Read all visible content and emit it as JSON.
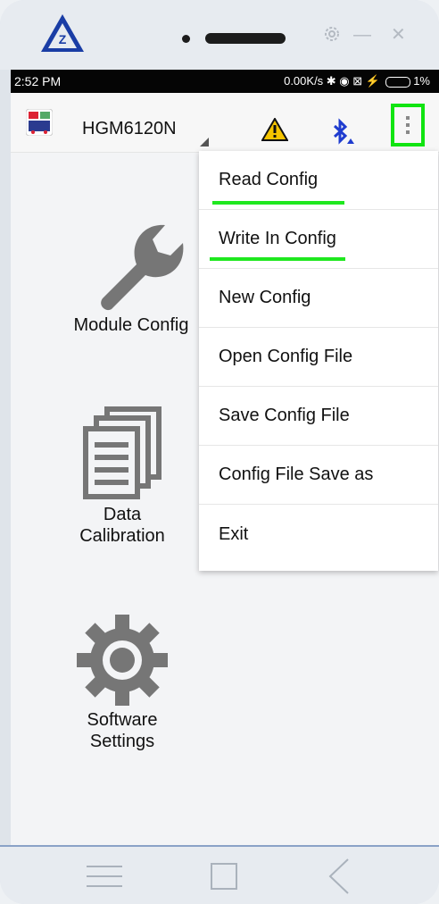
{
  "status_bar": {
    "time": "2:52 PM",
    "right": "0.00K/s ✱ ◉ ⊠ ⚡",
    "battery": "1%"
  },
  "app_bar": {
    "device_name": "HGM6120N",
    "icons": [
      "warning-icon",
      "bluetooth-icon",
      "overflow-menu-icon"
    ]
  },
  "home": {
    "items": [
      {
        "label": "Module Config",
        "icon": "wrench-icon"
      },
      {
        "label": "Data\nCalibration",
        "icon": "documents-icon"
      },
      {
        "label": "Software\nSettings",
        "icon": "gear-icon"
      }
    ]
  },
  "menu": {
    "items": [
      {
        "label": "Read Config"
      },
      {
        "label": "Write In Config"
      },
      {
        "label": "New Config"
      },
      {
        "label": "Open Config File"
      },
      {
        "label": "Save Config File"
      },
      {
        "label": "Config File Save as"
      },
      {
        "label": "Exit"
      }
    ]
  },
  "colors": {
    "highlight_green": "#11e411",
    "bluetooth_blue": "#1f3ccf",
    "warning_yellow": "#f5c400"
  }
}
